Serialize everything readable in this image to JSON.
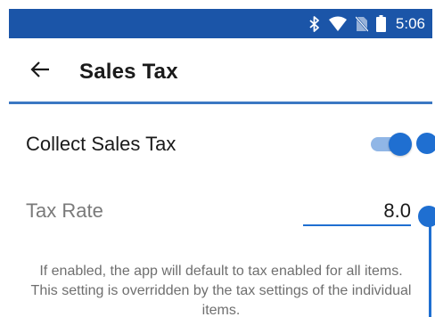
{
  "status_bar": {
    "time": "5:06",
    "icons": [
      "bluetooth-icon",
      "wifi-icon",
      "no-sim-icon",
      "battery-icon"
    ]
  },
  "toolbar": {
    "back_icon": "arrow-left-icon",
    "title": "Sales Tax"
  },
  "settings": {
    "collect_sales_tax": {
      "label": "Collect Sales Tax",
      "enabled": true
    },
    "tax_rate": {
      "label": "Tax Rate",
      "value": "8.0"
    },
    "help_text": "If enabled, the app will default to tax enabled for all items. This setting is overridden by the tax settings of the individual items."
  },
  "colors": {
    "primary": "#1b55a8",
    "accent": "#1f6fd1",
    "switch_track": "#90b6e6",
    "text": "#1a1a1a",
    "muted_text": "#7a7a7a"
  }
}
